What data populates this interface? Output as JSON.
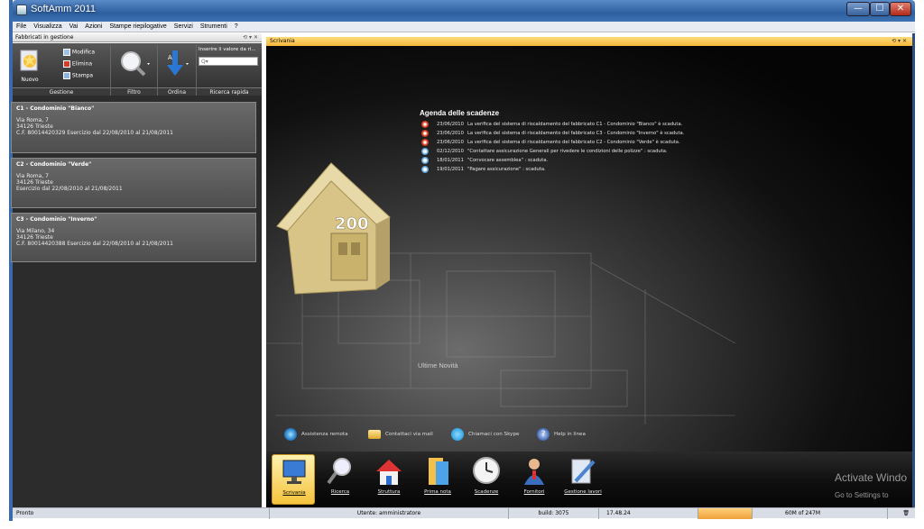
{
  "window": {
    "title": "SoftAmm 2011",
    "minimize": "—",
    "maximize": "☐",
    "close": "✕"
  },
  "menu": [
    "File",
    "Visualizza",
    "Vai",
    "Azioni",
    "Stampe riepilogative",
    "Servizi",
    "Strumenti",
    "?"
  ],
  "left_panel": {
    "header": "Fabbricati in gestione",
    "header_controls": "⟲ ▾ ✕",
    "ribbon": {
      "nuovo": "Nuovo",
      "modifica": "Modifica",
      "elimina": "Elimina",
      "stampa": "Stampa",
      "search_label": "Inserire il valore da ri...",
      "search_placeholder": "Q▾",
      "groups": [
        "Gestione",
        "Filtro",
        "Ordina",
        "Ricerca rapida"
      ]
    },
    "buildings": [
      {
        "title": "C1 - Condominio \"Bianco\"",
        "line1": "Via Roma, 7",
        "line2": "34126 Trieste",
        "line3": "C.F. 80014420329 Esercizio dal 22/08/2010 al 21/08/2011"
      },
      {
        "title": "C2 - Condominio \"Verde\"",
        "line1": "Via Roma, 7",
        "line2": "34126 Trieste",
        "line3": "Esercizio dal 22/08/2010 al 21/08/2011"
      },
      {
        "title": "C3 - Condominio \"Inverno\"",
        "line1": "Via Milano, 34",
        "line2": "34126 Trieste",
        "line3": "C.F. 80014420388 Esercizio dal 22/08/2010 al 21/08/2011"
      }
    ]
  },
  "right_panel": {
    "header": "Scrivania",
    "header_controls": "⟲ ▾ ✕",
    "agenda_title": "Agenda delle scadenze",
    "agenda": [
      {
        "date": "23/06/2010",
        "text": "La verifica del sistema di riscaldamento del fabbricato C1 - Condominio \"Bianco\" è scaduta.",
        "type": "alert"
      },
      {
        "date": "23/06/2010",
        "text": "La verifica del sistema di riscaldamento del fabbricato C3 - Condominio \"Inverno\" è scaduta.",
        "type": "alert"
      },
      {
        "date": "23/06/2010",
        "text": "La verifica del sistema di riscaldamento del fabbricato C2 - Condominio \"Verde\" è scaduta.",
        "type": "alert"
      },
      {
        "date": "02/12/2010",
        "text": "\"Contattare assicurazione Generali per rivedere le condizioni delle polizze\" : scaduta.",
        "type": "clock"
      },
      {
        "date": "18/01/2011",
        "text": "\"Convocare assemblea\" : scaduta.",
        "type": "clock"
      },
      {
        "date": "19/01/2011",
        "text": "\"Pagare assicurazione\" : scaduta.",
        "type": "clock"
      }
    ],
    "news_title": "Ultime Novità",
    "links": [
      "Assistenza remota",
      "Contattaci via mail",
      "Chiamaci con Skype",
      "Help in linea"
    ],
    "dock": [
      "Scrivania",
      "Ricerca",
      "Struttura",
      "Prima nota",
      "Scadenze",
      "Fornitori",
      "Gestione lavori"
    ]
  },
  "status": {
    "ready": "Pronto",
    "user": "Utente: amministratore",
    "build": "build: 3075",
    "time": "17.48.24",
    "memory": "60M of 247M"
  },
  "watermark": {
    "line1": "Activate Windo",
    "line2": "Go to Settings to"
  },
  "colors": {
    "accent": "#f6b73a",
    "title_bar": "#2d5f9e",
    "alert": "#e8482b",
    "clock": "#6fb0e8"
  },
  "banknote_value": "200"
}
